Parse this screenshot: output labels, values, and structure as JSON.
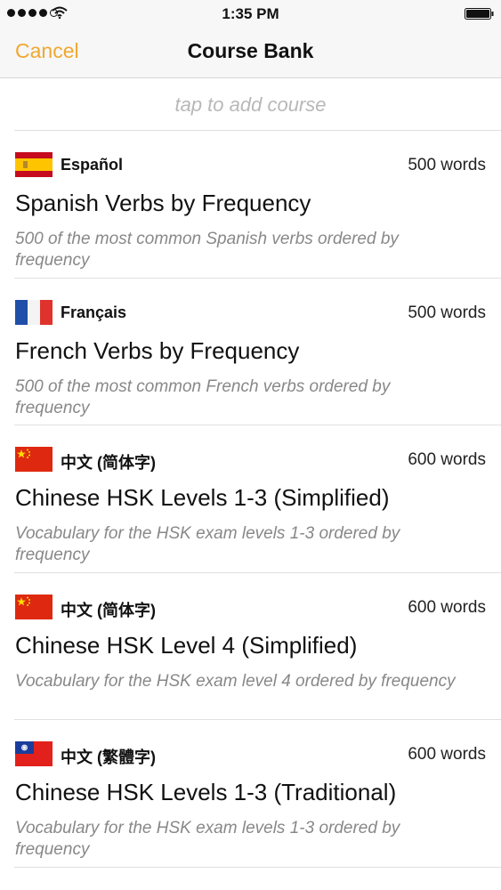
{
  "status_bar": {
    "time": "1:35 PM",
    "signal_icon": "signal-dots-icon",
    "wifi_icon": "wifi-icon",
    "battery_icon": "battery-icon"
  },
  "nav": {
    "cancel_label": "Cancel",
    "title": "Course Bank"
  },
  "add_course": {
    "hint": "tap to add course"
  },
  "colors": {
    "accent": "#f0a830",
    "hint": "#b8b8b8",
    "description": "#888888"
  },
  "courses": [
    {
      "flag_icon": "spain-flag-icon",
      "language": "Español",
      "words": "500 words",
      "name": "Spanish Verbs by Frequency",
      "description": "500 of the most common Spanish verbs ordered by frequency"
    },
    {
      "flag_icon": "france-flag-icon",
      "language": "Français",
      "words": "500 words",
      "name": "French Verbs by Frequency",
      "description": "500 of the most common French verbs ordered by frequency"
    },
    {
      "flag_icon": "china-flag-icon",
      "language": "中文 (简体字)",
      "words": "600 words",
      "name": "Chinese HSK Levels 1-3 (Simplified)",
      "description": "Vocabulary for the HSK exam levels 1-3 ordered by frequency"
    },
    {
      "flag_icon": "china-flag-icon",
      "language": "中文 (简体字)",
      "words": "600 words",
      "name": "Chinese HSK Level 4 (Simplified)",
      "description": "Vocabulary for the HSK exam level 4 ordered by frequency"
    },
    {
      "flag_icon": "taiwan-flag-icon",
      "language": "中文 (繁體字)",
      "words": "600 words",
      "name": "Chinese HSK Levels 1-3 (Traditional)",
      "description": "Vocabulary for the HSK exam levels 1-3 ordered by frequency"
    }
  ]
}
